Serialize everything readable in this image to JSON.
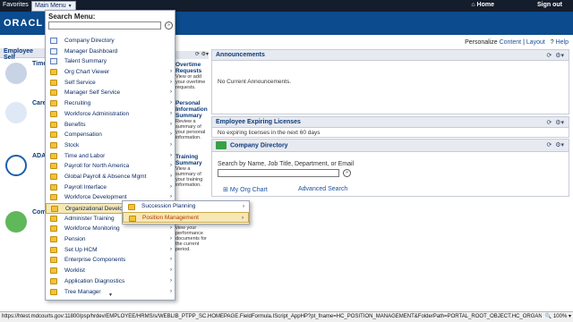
{
  "topbar": {
    "favorites": "Favorites",
    "main_menu": "Main Menu",
    "home": "Home",
    "sign_out": "Sign out"
  },
  "brand": {
    "logo": "ORACL"
  },
  "personalize": {
    "label": "Personalize",
    "content": "Content",
    "layout": "Layout",
    "sep": "|",
    "help": "Help"
  },
  "left": {
    "panel_title": "Employee Self",
    "tiles": [
      {
        "title": "Time",
        "icon": "time-icon"
      },
      {
        "title": "Care",
        "icon": "career-icon"
      },
      {
        "title": "ADA",
        "icon": "wheelchair-icon"
      },
      {
        "title": "Comp",
        "icon": "compensation-icon"
      }
    ],
    "side_panels": [
      {
        "title": "Overtime Requests",
        "desc": "View or add your overtime requests."
      },
      {
        "title": "Personal Information Summary",
        "desc": "Review a summary of your personal information."
      },
      {
        "title": "Training Summary",
        "desc": "View a summary of your training information."
      },
      {
        "title": "",
        "desc": "view your performance documents for the current period."
      }
    ]
  },
  "panels": {
    "announcements": {
      "title": "Announcements",
      "body": "No Current Announcements."
    },
    "expiring": {
      "title": "Employee Expiring Licenses",
      "body": "No expiring licenses in the next 60 days"
    },
    "directory": {
      "title": "Company Directory",
      "search_label": "Search by Name, Job Title, Department, or Email",
      "link_org": "My Org Chart",
      "link_adv": "Advanced Search"
    }
  },
  "menu": {
    "title": "Search Menu:",
    "items": [
      {
        "label": "Company Directory",
        "type": "doc",
        "submenu": false
      },
      {
        "label": "Manager Dashboard",
        "type": "doc",
        "submenu": false
      },
      {
        "label": "Talent Summary",
        "type": "doc",
        "submenu": false
      },
      {
        "label": "Org Chart Viewer",
        "type": "folder",
        "submenu": true
      },
      {
        "label": "Self Service",
        "type": "folder",
        "submenu": true
      },
      {
        "label": "Manager Self Service",
        "type": "folder",
        "submenu": true
      },
      {
        "label": "Recruiting",
        "type": "folder",
        "submenu": true
      },
      {
        "label": "Workforce Administration",
        "type": "folder",
        "submenu": true
      },
      {
        "label": "Benefits",
        "type": "folder",
        "submenu": true
      },
      {
        "label": "Compensation",
        "type": "folder",
        "submenu": true
      },
      {
        "label": "Stock",
        "type": "folder",
        "submenu": true
      },
      {
        "label": "Time and Labor",
        "type": "folder",
        "submenu": true
      },
      {
        "label": "Payroll for North America",
        "type": "folder",
        "submenu": true
      },
      {
        "label": "Global Payroll & Absence Mgmt",
        "type": "folder",
        "submenu": true
      },
      {
        "label": "Payroll Interface",
        "type": "folder",
        "submenu": true
      },
      {
        "label": "Workforce Development",
        "type": "folder",
        "submenu": true
      },
      {
        "label": "Organizational Develop",
        "type": "folder",
        "submenu": true,
        "active": true
      },
      {
        "label": "Administer Training",
        "type": "folder",
        "submenu": true
      },
      {
        "label": "Workforce Monitoring",
        "type": "folder",
        "submenu": true
      },
      {
        "label": "Pension",
        "type": "folder",
        "submenu": true
      },
      {
        "label": "Set Up HCM",
        "type": "folder",
        "submenu": true
      },
      {
        "label": "Enterprise Components",
        "type": "folder",
        "submenu": true
      },
      {
        "label": "Worklist",
        "type": "folder",
        "submenu": true
      },
      {
        "label": "Application Diagnostics",
        "type": "folder",
        "submenu": true
      },
      {
        "label": "Tree Manager",
        "type": "folder",
        "submenu": true
      }
    ],
    "more_glyph": "▼"
  },
  "submenu": {
    "items": [
      {
        "label": "Succession Planning",
        "active": false
      },
      {
        "label": "Position Management",
        "active": true
      }
    ]
  },
  "statusbar": {
    "url": "https://htest.mdcourts.gov:11800/psp/hrdev/EMPLOYEE/HRMS/s/WEBLIB_PTPP_SC.HOMEPAGE.FieldFormula.IScript_AppHP?pt_fname=HC_POSITION_MANAGEMENT&FolderPath=PORTAL_ROOT_OBJECT.HC_ORGANIZAT",
    "zoom": "100%"
  },
  "colors": {
    "topbar": "#141d2c",
    "band": "#0c4b8d",
    "highlight": "#f6e8b5"
  }
}
